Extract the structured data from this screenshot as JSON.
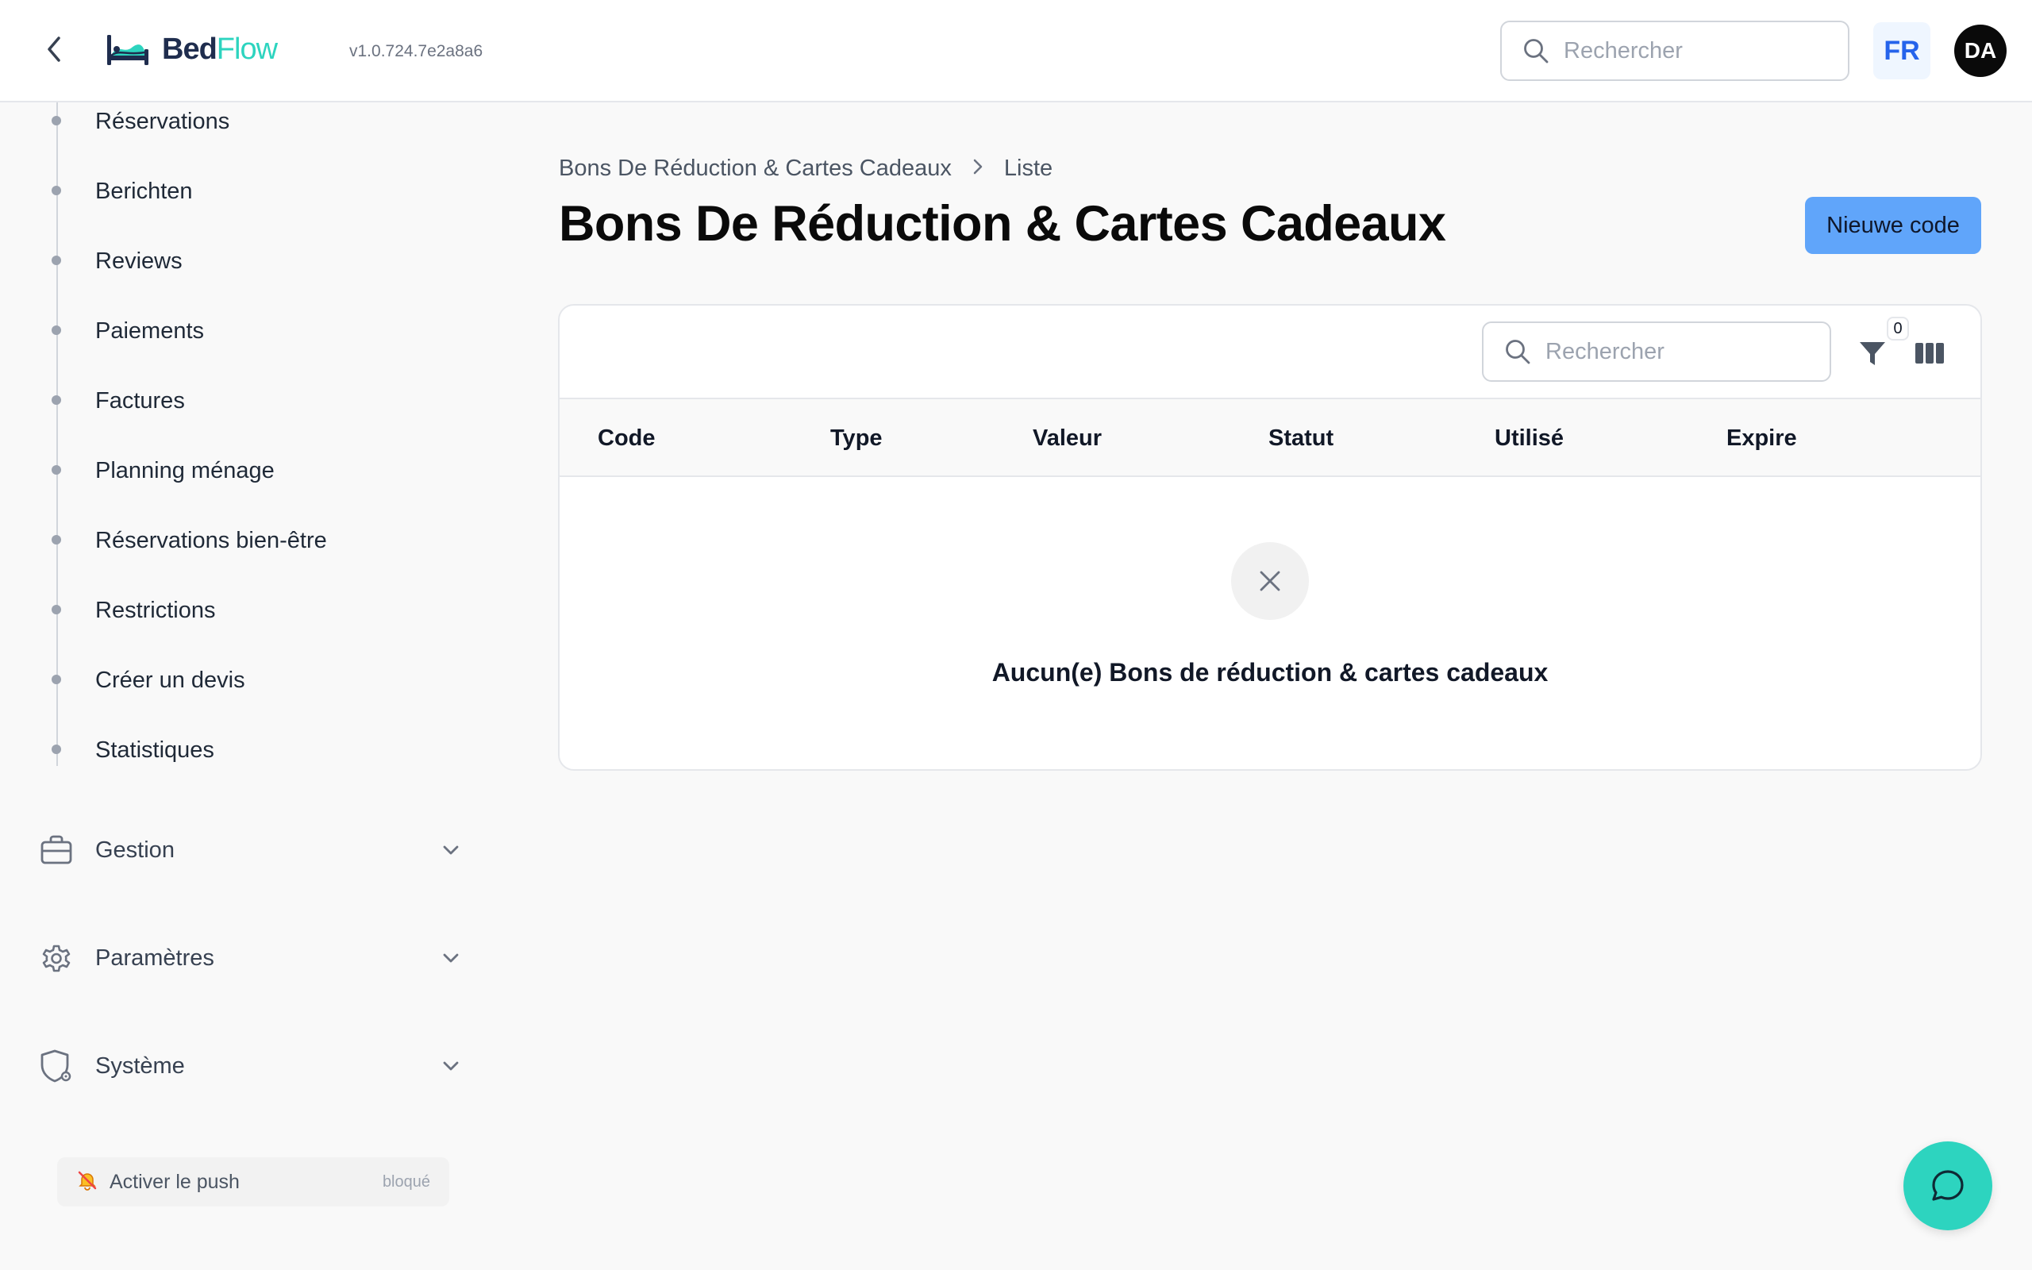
{
  "header": {
    "logo_part1": "Bed",
    "logo_part2": "Flow",
    "version": "v1.0.724.7e2a8a6",
    "search_placeholder": "Rechercher",
    "language": "FR",
    "user_initials": "DA"
  },
  "sidebar": {
    "sub_items": [
      {
        "label": "Réservations"
      },
      {
        "label": "Berichten"
      },
      {
        "label": "Reviews"
      },
      {
        "label": "Paiements"
      },
      {
        "label": "Factures"
      },
      {
        "label": "Planning ménage"
      },
      {
        "label": "Réservations bien-être"
      },
      {
        "label": "Restrictions"
      },
      {
        "label": "Créer un devis"
      },
      {
        "label": "Statistiques"
      }
    ],
    "groups": [
      {
        "label": "Gestion",
        "icon": "briefcase-icon"
      },
      {
        "label": "Paramètres",
        "icon": "gear-icon"
      },
      {
        "label": "Système",
        "icon": "shield-cog-icon"
      }
    ],
    "push": {
      "label": "Activer le push",
      "status": "bloqué",
      "icon": "bell-off-icon"
    }
  },
  "main": {
    "breadcrumb": [
      "Bons De Réduction & Cartes Cadeaux",
      "Liste"
    ],
    "title": "Bons De Réduction & Cartes Cadeaux",
    "new_button": "Nieuwe code",
    "table": {
      "search_placeholder": "Rechercher",
      "filter_count": "0",
      "columns": [
        "Code",
        "Type",
        "Valeur",
        "Statut",
        "Utilisé",
        "Expire"
      ],
      "rows": [],
      "empty_message": "Aucun(e) Bons de réduction & cartes cadeaux"
    }
  },
  "colors": {
    "accent": "#60a5fa",
    "brand_teal": "#2dd4bf",
    "brand_navy": "#1f2d4e",
    "language_text": "#2563eb"
  }
}
